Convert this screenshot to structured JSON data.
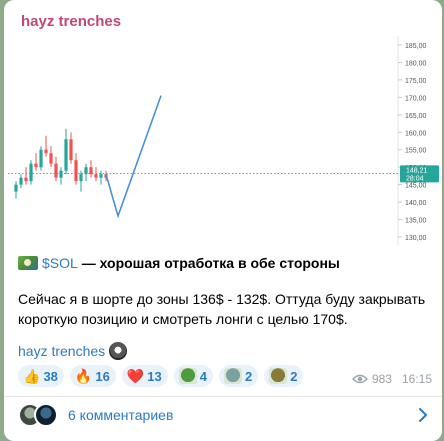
{
  "channel": {
    "name": "hayz trenches"
  },
  "chart": {
    "price_label": "148,21",
    "time_label": "28:04",
    "accent": "#4a90d9",
    "up_color": "#26a69a",
    "down_color": "#ef5350",
    "axis_ticks": [
      "185,00",
      "180,00",
      "175,00",
      "170,00",
      "165,00",
      "160,00",
      "155,00",
      "150,00",
      "145,00",
      "140,00",
      "135,00",
      "130,00"
    ]
  },
  "chart_data": {
    "type": "line",
    "title": "",
    "ylim": [
      128,
      187
    ],
    "yticks": [
      185,
      180,
      175,
      170,
      165,
      160,
      155,
      150,
      145,
      140,
      135,
      130
    ],
    "current_price": 148.21,
    "candles": [
      [
        143,
        146,
        141,
        145
      ],
      [
        145,
        148,
        144,
        147
      ],
      [
        147,
        150,
        145,
        146
      ],
      [
        146,
        152,
        145,
        151
      ],
      [
        151,
        154,
        149,
        150
      ],
      [
        150,
        156,
        149,
        155
      ],
      [
        155,
        159,
        153,
        154
      ],
      [
        154,
        156,
        150,
        151
      ],
      [
        151,
        153,
        146,
        147
      ],
      [
        147,
        150,
        145,
        149
      ],
      [
        149,
        161,
        148,
        158
      ],
      [
        158,
        160,
        151,
        152
      ],
      [
        152,
        154,
        145,
        146
      ],
      [
        146,
        149,
        143,
        148
      ],
      [
        148,
        151,
        146,
        150
      ],
      [
        150,
        152,
        147,
        148
      ],
      [
        148,
        150,
        146,
        147
      ],
      [
        147,
        149,
        145,
        148
      ],
      [
        148,
        149,
        146,
        147
      ]
    ],
    "projection": [
      [
        0,
        148
      ],
      [
        1,
        136
      ],
      [
        2,
        170.5
      ]
    ]
  },
  "post": {
    "coin": "$SOL",
    "headline": " — хорошая отработка в обе стороны",
    "body": "Сейчас я в шорте до  зоны 136$ - 132$. Оттуда буду закрывать короткую позицию и смотреть лонги с целью 170$.",
    "signature": "hayz trenches"
  },
  "reactions": [
    {
      "emoji": "👍",
      "count": "38"
    },
    {
      "emoji": "🔥",
      "count": "16"
    },
    {
      "emoji": "❤️",
      "count": "13"
    },
    {
      "emoji": "frog",
      "count": "4",
      "color": "#4f9a3f"
    },
    {
      "emoji": "dragon",
      "count": "2",
      "color": "#7aa0a0"
    },
    {
      "emoji": "sticker",
      "count": "2",
      "color": "#8a7a3a"
    }
  ],
  "meta": {
    "views": "983",
    "time": "16:15"
  },
  "comments": {
    "label": "6 комментариев"
  }
}
